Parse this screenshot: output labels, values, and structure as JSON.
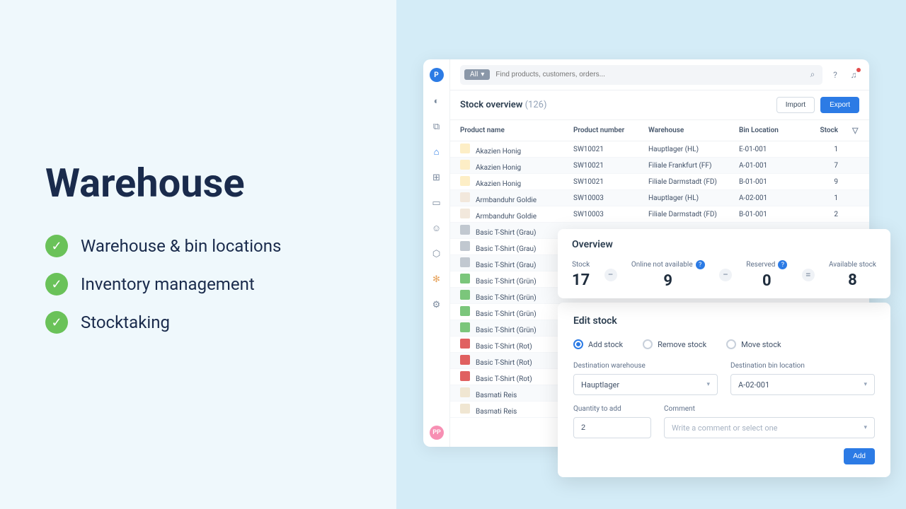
{
  "hero": {
    "title": "Warehouse",
    "features": [
      "Warehouse & bin locations",
      "Inventory management",
      "Stocktaking"
    ]
  },
  "app": {
    "logo": "P",
    "avatar": "PP",
    "search": {
      "filter_label": "All",
      "placeholder": "Find products, customers, orders..."
    },
    "header": {
      "title": "Stock overview",
      "count": "(126)",
      "import_btn": "Import",
      "export_btn": "Export"
    },
    "columns": {
      "name": "Product name",
      "number": "Product number",
      "warehouse": "Warehouse",
      "bin": "Bin Location",
      "stock": "Stock"
    },
    "rows": [
      {
        "icon": "ic-honey",
        "name": "Akazien Honig",
        "num": "SW10021",
        "wh": "Hauptlager (HL)",
        "bin": "E-01-001",
        "stock": "1"
      },
      {
        "icon": "ic-honey",
        "name": "Akazien Honig",
        "num": "SW10021",
        "wh": "Filiale Frankfurt (FF)",
        "bin": "A-01-001",
        "stock": "7"
      },
      {
        "icon": "ic-honey",
        "name": "Akazien Honig",
        "num": "SW10021",
        "wh": "Filiale Darmstadt (FD)",
        "bin": "B-01-001",
        "stock": "9"
      },
      {
        "icon": "ic-watch",
        "name": "Armbanduhr Goldie",
        "num": "SW10003",
        "wh": "Hauptlager (HL)",
        "bin": "A-02-001",
        "stock": "1"
      },
      {
        "icon": "ic-watch",
        "name": "Armbanduhr Goldie",
        "num": "SW10003",
        "wh": "Filiale Darmstadt (FD)",
        "bin": "B-01-001",
        "stock": "2"
      },
      {
        "icon": "ic-shirt-gray",
        "name": "Basic T-Shirt (Grau)",
        "num": "",
        "wh": "",
        "bin": "",
        "stock": ""
      },
      {
        "icon": "ic-shirt-gray",
        "name": "Basic T-Shirt (Grau)",
        "num": "",
        "wh": "",
        "bin": "",
        "stock": ""
      },
      {
        "icon": "ic-shirt-gray",
        "name": "Basic T-Shirt (Grau)",
        "num": "",
        "wh": "",
        "bin": "",
        "stock": ""
      },
      {
        "icon": "ic-shirt-green",
        "name": "Basic T-Shirt (Grün)",
        "num": "",
        "wh": "",
        "bin": "",
        "stock": ""
      },
      {
        "icon": "ic-shirt-green",
        "name": "Basic T-Shirt (Grün)",
        "num": "",
        "wh": "",
        "bin": "",
        "stock": ""
      },
      {
        "icon": "ic-shirt-green",
        "name": "Basic T-Shirt (Grün)",
        "num": "",
        "wh": "",
        "bin": "",
        "stock": ""
      },
      {
        "icon": "ic-shirt-green",
        "name": "Basic T-Shirt (Grün)",
        "num": "",
        "wh": "",
        "bin": "",
        "stock": ""
      },
      {
        "icon": "ic-shirt-red",
        "name": "Basic T-Shirt (Rot)",
        "num": "",
        "wh": "",
        "bin": "",
        "stock": ""
      },
      {
        "icon": "ic-shirt-red",
        "name": "Basic T-Shirt (Rot)",
        "num": "",
        "wh": "",
        "bin": "",
        "stock": ""
      },
      {
        "icon": "ic-shirt-red",
        "name": "Basic T-Shirt (Rot)",
        "num": "",
        "wh": "",
        "bin": "",
        "stock": ""
      },
      {
        "icon": "ic-rice",
        "name": "Basmati Reis",
        "num": "",
        "wh": "",
        "bin": "",
        "stock": ""
      },
      {
        "icon": "ic-rice",
        "name": "Basmati Reis",
        "num": "",
        "wh": "",
        "bin": "",
        "stock": ""
      }
    ]
  },
  "overview": {
    "title": "Overview",
    "stock_label": "Stock",
    "stock_val": "17",
    "online_na_label": "Online not available",
    "online_na_val": "9",
    "reserved_label": "Reserved",
    "reserved_val": "0",
    "available_label": "Available stock",
    "available_val": "8"
  },
  "edit": {
    "title": "Edit stock",
    "radio_add": "Add stock",
    "radio_remove": "Remove stock",
    "radio_move": "Move stock",
    "dest_wh_label": "Destination warehouse",
    "dest_wh_value": "Hauptlager",
    "dest_bin_label": "Destination bin location",
    "dest_bin_value": "A-02-001",
    "qty_label": "Quantity to add",
    "qty_value": "2",
    "comment_label": "Comment",
    "comment_placeholder": "Write a comment or select one",
    "add_btn": "Add"
  }
}
